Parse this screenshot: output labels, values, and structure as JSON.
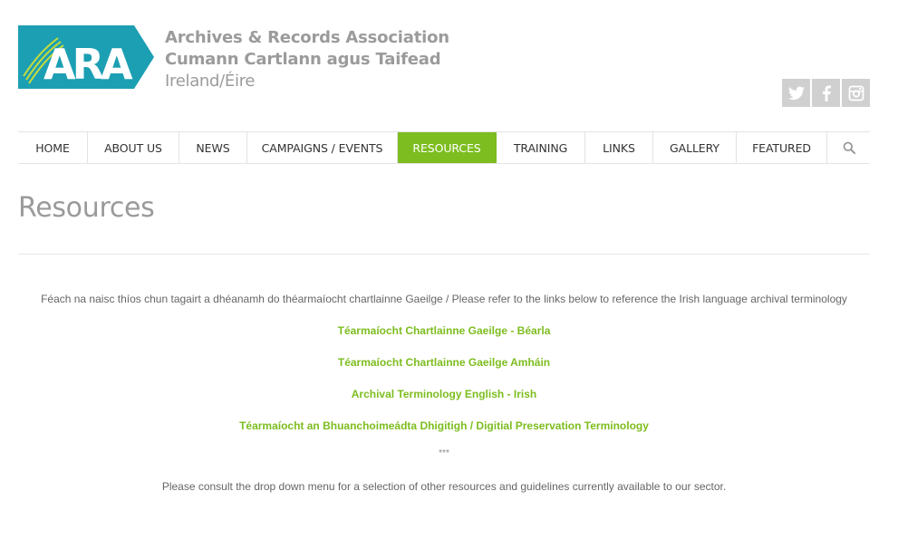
{
  "header": {
    "logo_text": "ARA",
    "brand_line1": "Archives & Records Association",
    "brand_line2": "Cumann Cartlann agus Taifead",
    "brand_line3": "Ireland/Éire",
    "social": [
      {
        "icon": "twitter-icon"
      },
      {
        "icon": "facebook-icon"
      },
      {
        "icon": "instagram-icon"
      }
    ]
  },
  "nav": {
    "items": [
      {
        "label": "HOME"
      },
      {
        "label": "ABOUT US"
      },
      {
        "label": "NEWS"
      },
      {
        "label": "CAMPAIGNS / EVENTS"
      },
      {
        "label": "RESOURCES"
      },
      {
        "label": "TRAINING"
      },
      {
        "label": "LINKS"
      },
      {
        "label": "GALLERY"
      },
      {
        "label": "FEATURED"
      }
    ],
    "active": "RESOURCES",
    "search_icon": "search-icon"
  },
  "page": {
    "title": "Resources",
    "intro": "Féach na naisc thíos chun tagairt a dhéanamh do théarmaíocht chartlainne Gaeilge / Please refer to the links below to reference the Irish language archival terminology",
    "links": [
      {
        "label": "Téarmaíocht Chartlainne Gaeilge - Béarla"
      },
      {
        "label": "Téarmaíocht Chartlainne Gaeilge Amháin"
      },
      {
        "label": "Archival Terminology English - Irish"
      },
      {
        "label": "Téarmaíocht an Bhuanchoimeádta Dhigitigh / Digitial Preservation Terminology"
      }
    ],
    "separator": "***",
    "outro": "Please consult the drop down menu for a selection of other resources and guidelines currently available to our sector."
  },
  "colors": {
    "accent": "#7dbd1f",
    "logo_teal": "#1c9fb3",
    "brand_gray": "#9b9b9b",
    "social_bg": "#d0d0d0"
  }
}
